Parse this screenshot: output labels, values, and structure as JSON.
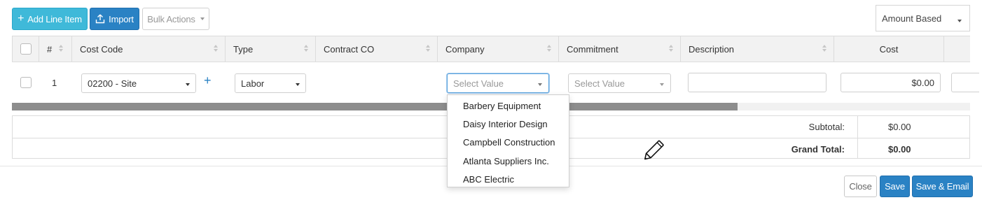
{
  "toolbar": {
    "add_line_item_label": "Add Line Item",
    "import_label": "Import",
    "bulk_actions_label": "Bulk Actions",
    "amount_mode": "Amount Based"
  },
  "grid": {
    "columns": [
      "#",
      "Cost Code",
      "Type",
      "Contract CO",
      "Company",
      "Commitment",
      "Description",
      "Cost"
    ],
    "row": {
      "number": "1",
      "cost_code": "02200 - Site",
      "type": "Labor",
      "company_placeholder": "Select Value",
      "commitment_placeholder": "Select Value",
      "description": "",
      "cost": "$0.00"
    }
  },
  "company_dropdown": {
    "options": [
      "Barbery Equipment",
      "Daisy Interior Design",
      "Campbell Construction",
      "Atlanta Suppliers Inc.",
      "ABC Electric"
    ]
  },
  "totals": {
    "subtotal_label": "Subtotal:",
    "subtotal_value": "$0.00",
    "grand_total_label": "Grand Total:",
    "grand_total_value": "$0.00"
  },
  "footer": {
    "close_label": "Close",
    "save_label": "Save",
    "save_email_label": "Save & Email"
  },
  "colors": {
    "teal": "#3fb9d9",
    "blue": "#2a82c4",
    "focus": "#57a2dd"
  },
  "icons": [
    "plus-icon",
    "upload-icon",
    "caret-down-icon",
    "sort-icon",
    "pencil-cursor-icon"
  ]
}
